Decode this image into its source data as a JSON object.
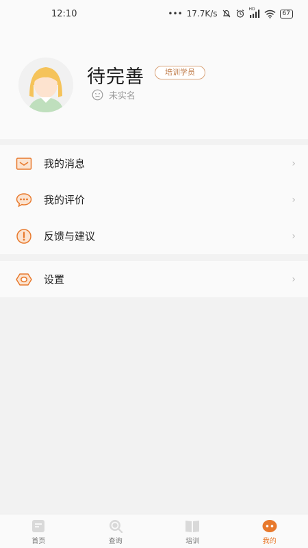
{
  "status_bar": {
    "time": "12:10",
    "net_speed": "17.7K/s",
    "battery": "67",
    "signal_tag": "HD"
  },
  "profile": {
    "name": "待完善",
    "role_badge": "培训学员",
    "realname_status": "未实名"
  },
  "menu_group_1": [
    {
      "label": "我的消息",
      "icon": "mail-icon"
    },
    {
      "label": "我的评价",
      "icon": "chat-bubble-icon"
    },
    {
      "label": "反馈与建议",
      "icon": "alert-circle-icon"
    }
  ],
  "menu_group_2": [
    {
      "label": "设置",
      "icon": "settings-eye-icon"
    }
  ],
  "chevron": "›",
  "bottom_nav": [
    {
      "label": "首页",
      "icon": "home-doc-icon",
      "active": false
    },
    {
      "label": "查询",
      "icon": "search-icon",
      "active": false
    },
    {
      "label": "培训",
      "icon": "training-book-icon",
      "active": false
    },
    {
      "label": "我的",
      "icon": "profile-face-icon",
      "active": true
    }
  ],
  "colors": {
    "accent": "#e8792c",
    "badge_border": "#d9a37a",
    "background": "#f2f2f2",
    "card": "#fafafa"
  }
}
